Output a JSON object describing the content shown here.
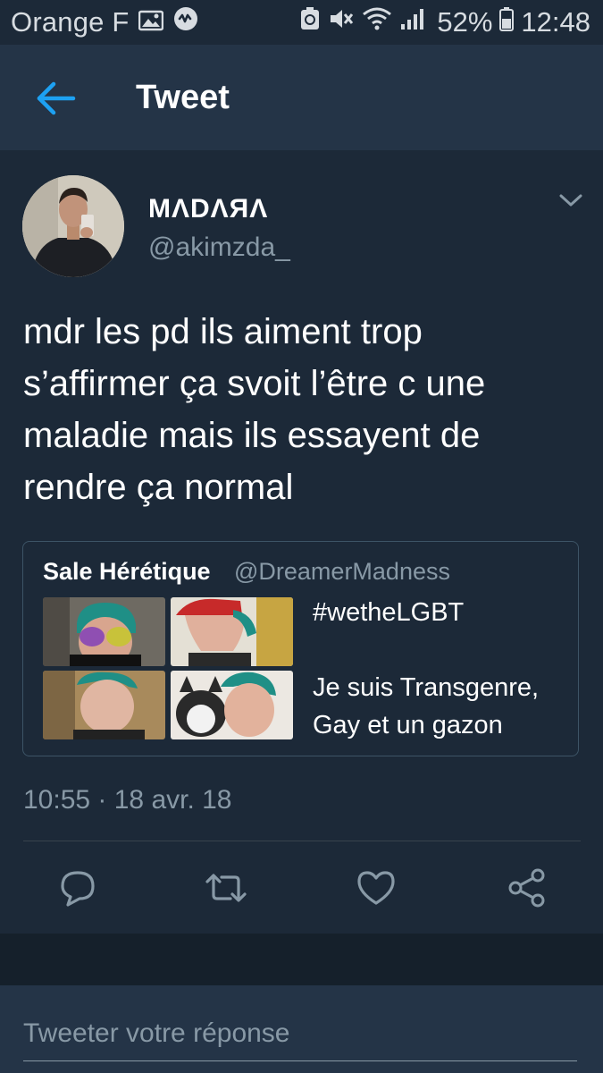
{
  "status_bar": {
    "carrier": "Orange F",
    "battery": "52%",
    "time": "12:48",
    "icons": [
      "image-icon",
      "musically-icon",
      "silent-icon",
      "wifi-icon",
      "signal-icon",
      "battery-icon"
    ]
  },
  "header": {
    "title": "Tweet",
    "back_icon": "arrow-left-icon",
    "accent_color": "#1da1f2"
  },
  "tweet": {
    "display_name": "MΛDΛЯΛ",
    "handle": "@akimzda_",
    "text": "mdr les pd ils aiment trop\ns’affirmer ça svoit l’être c une\nmaladie mais ils essayent de\nrendre ça normal",
    "timestamp": "10:55 · 18 avr. 18"
  },
  "quoted_tweet": {
    "display_name": "Sale Hérétique",
    "handle": "@DreamerMadness",
    "text": "#wetheLGBT\n\nJe suis Transgenre,\nGay et un gazon",
    "image_count": 4
  },
  "actions": [
    "reply-icon",
    "retweet-icon",
    "like-icon",
    "share-icon"
  ],
  "reply": {
    "placeholder": "Tweeter votre réponse"
  },
  "colors": {
    "background": "#1c2938",
    "header": "#243447",
    "muted_text": "#8899a6",
    "border": "#38444d"
  }
}
